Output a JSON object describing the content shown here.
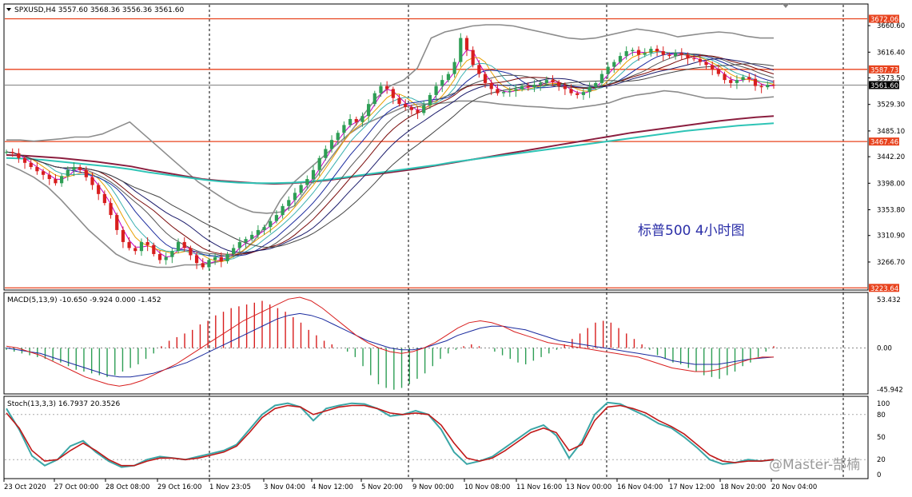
{
  "symbol_header": "SPXUSD,H4  3557.60 3568.36 3556.36 3561.60",
  "annotation": "标普500  4小时图",
  "watermark": "@Master-郜楠",
  "colors": {
    "bull": "#2e9e55",
    "bear": "#d81e1e",
    "level": "#e8431e",
    "bollinger": "#8c8c8c",
    "macd_signal": "#1a2a9e",
    "macd_line": "#d81e1e",
    "stoch_main": "#3aa6a6",
    "stoch_signal": "#c01818"
  },
  "chart_data": [
    {
      "type": "candlestick",
      "name": "price",
      "title": "SPXUSD,H4",
      "ylim": [
        3224,
        3690
      ],
      "y_ticks": [
        "3660.60",
        "3616.40",
        "3573.50",
        "3529.30",
        "3485.10",
        "3442.20",
        "3398.00",
        "3353.80",
        "3310.90",
        "3266.70"
      ],
      "x_ticks": [
        "23 Oct 2020",
        "27 Oct 00:00",
        "28 Oct 08:00",
        "29 Oct 16:00",
        "1 Nov 23:05",
        "3 Nov 04:00",
        "4 Nov 12:00",
        "5 Nov 20:00",
        "9 Nov 00:00",
        "10 Nov 08:00",
        "11 Nov 16:00",
        "13 Nov 00:00",
        "16 Nov 04:00",
        "17 Nov 12:00",
        "18 Nov 20:00",
        "20 Nov 04:00"
      ],
      "horizontal_levels": [
        "3672.06",
        "3587.73",
        "3467.46",
        "3223.64"
      ],
      "current_price": "3561.60",
      "close_series": [
        3450,
        3448,
        3440,
        3432,
        3425,
        3418,
        3412,
        3405,
        3398,
        3410,
        3420,
        3425,
        3420,
        3408,
        3395,
        3380,
        3365,
        3345,
        3320,
        3300,
        3290,
        3285,
        3300,
        3295,
        3280,
        3270,
        3275,
        3285,
        3300,
        3290,
        3278,
        3265,
        3258,
        3270,
        3275,
        3268,
        3280,
        3290,
        3300,
        3305,
        3312,
        3320,
        3325,
        3335,
        3345,
        3360,
        3370,
        3382,
        3395,
        3405,
        3420,
        3440,
        3455,
        3470,
        3482,
        3495,
        3505,
        3500,
        3510,
        3530,
        3548,
        3560,
        3555,
        3540,
        3530,
        3525,
        3520,
        3515,
        3528,
        3545,
        3560,
        3570,
        3580,
        3600,
        3640,
        3620,
        3595,
        3580,
        3565,
        3555,
        3548,
        3550,
        3552,
        3555,
        3560,
        3558,
        3562,
        3565,
        3570,
        3566,
        3560,
        3555,
        3548,
        3545,
        3550,
        3558,
        3565,
        3580,
        3592,
        3600,
        3610,
        3618,
        3620,
        3612,
        3615,
        3622,
        3618,
        3612,
        3610,
        3615,
        3612,
        3606,
        3605,
        3600,
        3595,
        3588,
        3580,
        3570,
        3565,
        3570,
        3575,
        3572,
        3560,
        3558,
        3562,
        3561.6
      ],
      "bollinger_upper": [
        3470,
        3470,
        3468,
        3470,
        3472,
        3475,
        3475,
        3480,
        3490,
        3500,
        3480,
        3460,
        3440,
        3420,
        3400,
        3385,
        3370,
        3358,
        3350,
        3348,
        3350,
        3360,
        3390,
        3420,
        3450,
        3480,
        3510,
        3540,
        3560,
        3570,
        3590,
        3640,
        3650,
        3655,
        3660,
        3662,
        3662,
        3660,
        3655,
        3650,
        3645,
        3640,
        3638,
        3640,
        3645,
        3650,
        3655,
        3652,
        3648,
        3642,
        3645,
        3648,
        3650,
        3648,
        3643,
        3640,
        3640
      ],
      "bollinger_lower": [
        3430,
        3420,
        3408,
        3392,
        3370,
        3345,
        3320,
        3300,
        3280,
        3268,
        3262,
        3258,
        3258,
        3262,
        3262,
        3265,
        3270,
        3280,
        3300,
        3330,
        3370,
        3400,
        3420,
        3440,
        3460,
        3480,
        3495,
        3505,
        3515,
        3525,
        3530,
        3530,
        3532,
        3535,
        3535,
        3533,
        3530,
        3528,
        3526,
        3525,
        3523,
        3522,
        3525,
        3528,
        3532,
        3540,
        3545,
        3548,
        3552,
        3550,
        3545,
        3540,
        3540,
        3538,
        3538,
        3540,
        3542
      ],
      "ma_slow_1": [
        3445,
        3444,
        3442,
        3440,
        3437,
        3434,
        3430,
        3426,
        3420,
        3415,
        3410,
        3405,
        3402,
        3400,
        3398,
        3397,
        3398,
        3400,
        3403,
        3407,
        3411,
        3414,
        3418,
        3422,
        3427,
        3432,
        3437,
        3442,
        3447,
        3452,
        3457,
        3462,
        3467,
        3472,
        3477,
        3482,
        3486,
        3490,
        3494,
        3498,
        3502,
        3505,
        3508,
        3510
      ],
      "ma_slow_2": [
        3440,
        3439,
        3437,
        3434,
        3431,
        3428,
        3425,
        3421,
        3416,
        3412,
        3408,
        3404,
        3401,
        3399,
        3398,
        3398,
        3399,
        3401,
        3404,
        3408,
        3412,
        3416,
        3420,
        3424,
        3428,
        3433,
        3437,
        3441,
        3445,
        3449,
        3453,
        3457,
        3461,
        3465,
        3469,
        3473,
        3477,
        3481,
        3485,
        3488,
        3491,
        3494,
        3496,
        3498
      ]
    },
    {
      "type": "macd",
      "title": "MACD(5,13,9) -10.650 -9.924 0.000 -1.452",
      "y_ticks": [
        "53.432",
        "0.00",
        "-45.942"
      ],
      "histogram": [
        -2,
        -4,
        -6,
        -8,
        -10,
        -12,
        -14,
        -16,
        -20,
        -24,
        -26,
        -28,
        -30,
        -32,
        -30,
        -26,
        -22,
        -18,
        -12,
        -6,
        2,
        8,
        12,
        16,
        20,
        26,
        30,
        36,
        40,
        44,
        46,
        48,
        50,
        52,
        48,
        44,
        40,
        34,
        28,
        20,
        14,
        8,
        4,
        0,
        -4,
        -10,
        -20,
        -30,
        -40,
        -44,
        -46,
        -44,
        -40,
        -34,
        -28,
        -20,
        -12,
        -6,
        -2,
        2,
        4,
        2,
        0,
        -4,
        -8,
        -12,
        -16,
        -18,
        -14,
        -10,
        -6,
        -2,
        4,
        10,
        16,
        22,
        28,
        30,
        28,
        22,
        16,
        10,
        4,
        -2,
        -8,
        -12,
        -16,
        -18,
        -22,
        -26,
        -30,
        -32,
        -34,
        -30,
        -26,
        -20,
        -16,
        -10,
        -4,
        2
      ],
      "main_line": [
        2,
        0,
        -4,
        -8,
        -14,
        -20,
        -26,
        -32,
        -36,
        -40,
        -42,
        -40,
        -36,
        -30,
        -24,
        -18,
        -10,
        -2,
        6,
        14,
        22,
        30,
        36,
        42,
        48,
        54,
        56,
        52,
        44,
        34,
        24,
        14,
        6,
        0,
        -4,
        -6,
        -4,
        0,
        6,
        14,
        22,
        28,
        30,
        28,
        24,
        18,
        14,
        10,
        6,
        4,
        2,
        0,
        -2,
        -4,
        -6,
        -8,
        -10,
        -14,
        -18,
        -22,
        -24,
        -26,
        -26,
        -24,
        -20,
        -16,
        -12,
        -10,
        -10
      ],
      "signal_line": [
        0,
        -2,
        -4,
        -6,
        -10,
        -14,
        -18,
        -22,
        -26,
        -30,
        -32,
        -32,
        -30,
        -28,
        -24,
        -20,
        -16,
        -10,
        -4,
        2,
        8,
        14,
        20,
        26,
        32,
        36,
        38,
        36,
        32,
        26,
        20,
        14,
        8,
        4,
        0,
        -2,
        -2,
        0,
        4,
        8,
        14,
        18,
        22,
        24,
        24,
        22,
        20,
        16,
        12,
        8,
        6,
        4,
        2,
        0,
        -2,
        -4,
        -6,
        -8,
        -10,
        -14,
        -16,
        -18,
        -18,
        -18,
        -16,
        -14,
        -12,
        -11,
        -10
      ]
    },
    {
      "type": "stochastic",
      "title": "Stoch(13,3,3) 16.7937 20.3526",
      "y_ticks": [
        "100",
        "80",
        "50",
        "20",
        "0"
      ],
      "main_line": [
        88,
        60,
        25,
        12,
        20,
        38,
        45,
        30,
        18,
        10,
        12,
        20,
        24,
        22,
        20,
        24,
        28,
        32,
        40,
        60,
        80,
        92,
        95,
        90,
        72,
        88,
        92,
        95,
        94,
        88,
        78,
        80,
        85,
        80,
        60,
        30,
        14,
        18,
        24,
        36,
        48,
        60,
        66,
        52,
        22,
        44,
        80,
        96,
        94,
        86,
        78,
        68,
        62,
        50,
        36,
        20,
        14,
        16,
        20,
        18,
        20
      ],
      "signal_line": [
        82,
        62,
        32,
        18,
        20,
        32,
        42,
        32,
        20,
        12,
        12,
        18,
        22,
        22,
        20,
        22,
        26,
        30,
        38,
        56,
        76,
        88,
        92,
        90,
        80,
        85,
        90,
        92,
        92,
        88,
        82,
        80,
        82,
        80,
        66,
        42,
        22,
        18,
        22,
        32,
        44,
        56,
        62,
        56,
        32,
        40,
        72,
        90,
        92,
        88,
        82,
        72,
        64,
        54,
        40,
        26,
        18,
        16,
        18,
        18,
        20
      ]
    }
  ]
}
